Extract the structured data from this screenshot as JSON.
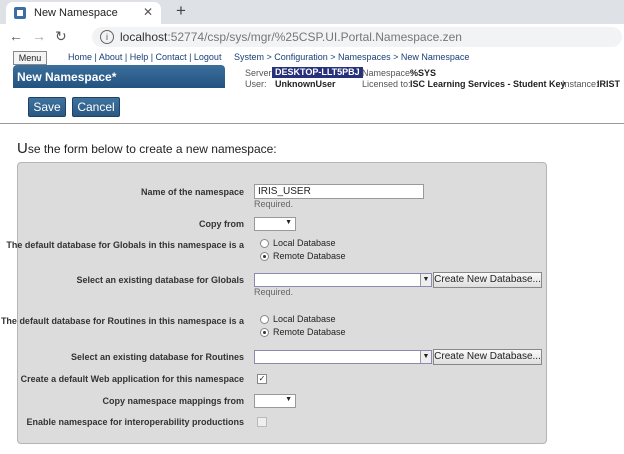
{
  "browser": {
    "tab_title": "New Namespace",
    "url_host": "localhost",
    "url_path": ":52774/csp/sys/mgr/%25CSP.UI.Portal.Namespace.zen"
  },
  "portal": {
    "menu_label": "Menu",
    "top_links": "Home | About | Help | Contact | Logout",
    "breadcrumb": "System > Configuration > Namespaces > New Namespace",
    "page_title": "New Namespace*",
    "server_label": "Server:",
    "server_value": "DESKTOP-LLT5PBJ",
    "namespace_label": "Namespace:",
    "namespace_value": "%SYS",
    "user_label": "User:",
    "user_value": "UnknownUser",
    "licensed_label": "Licensed to:",
    "licensed_value": "ISC Learning Services - Student Key",
    "instance_label": "Instance:",
    "instance_value": "IRIST"
  },
  "toolbar": {
    "save_label": "Save",
    "cancel_label": "Cancel"
  },
  "intro": {
    "first_letter": "U",
    "rest": "se the form below to create a new namespace:"
  },
  "form": {
    "name_label": "Name of the namespace",
    "name_value": "IRIS_USER",
    "required_text": "Required.",
    "copy_from_label": "Copy from",
    "globals_db_label": "The default database for Globals in this namespace is a",
    "local_db_label": "Local Database",
    "remote_db_label": "Remote Database",
    "select_globals_label": "Select an existing database for Globals",
    "create_db_label": "Create New Database...",
    "routines_db_label": "The default database for Routines in this namespace is a",
    "select_routines_label": "Select an existing database for Routines",
    "web_app_label": "Create a default Web application for this namespace",
    "web_app_checked": true,
    "copy_mappings_label": "Copy namespace mappings from",
    "interop_label": "Enable namespace for interoperability productions",
    "interop_checked": false
  },
  "colors": {
    "accent": "#2a5882",
    "server_badge": "#27307a"
  }
}
